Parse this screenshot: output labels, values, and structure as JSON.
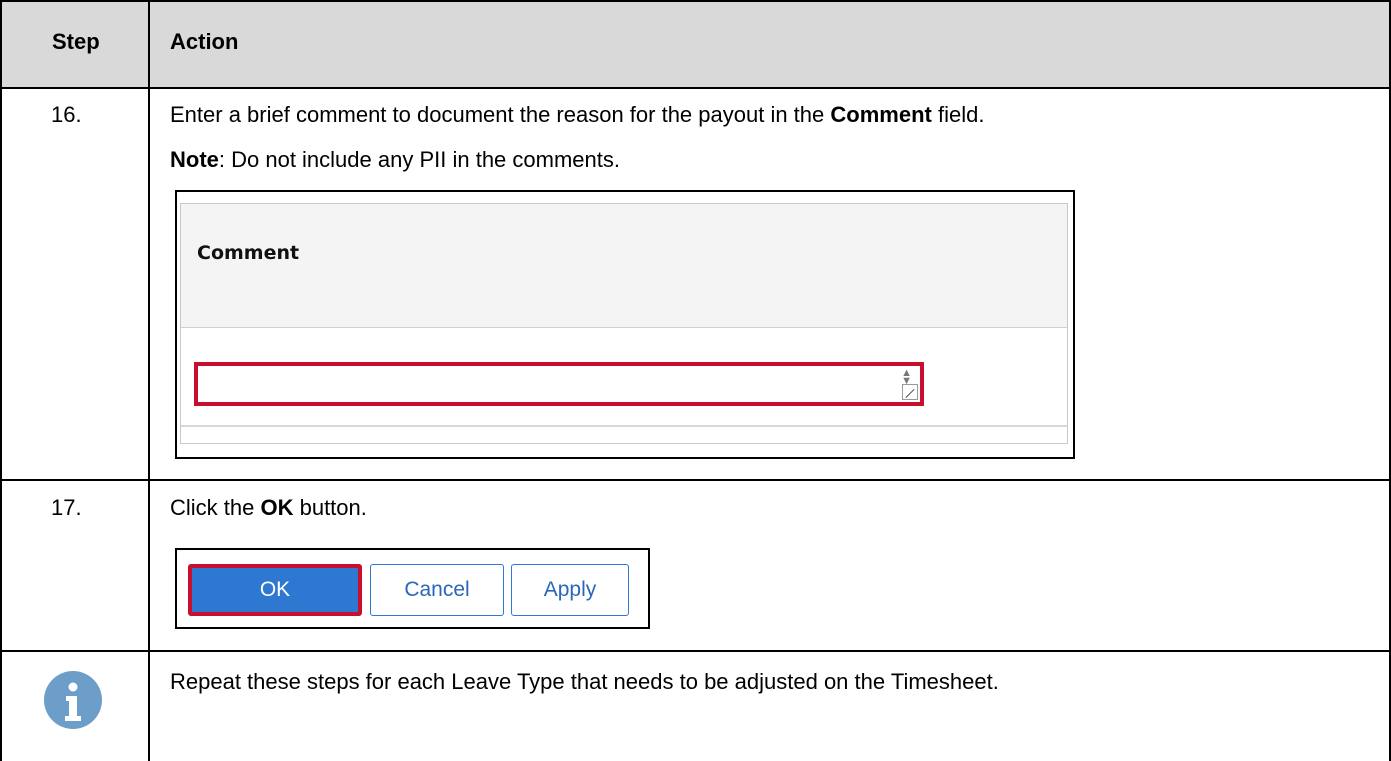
{
  "table": {
    "headers": {
      "step": "Step",
      "action": "Action"
    }
  },
  "rows": [
    {
      "step": "16.",
      "instruction": {
        "pre": "Enter a brief comment to document the reason for the payout in the ",
        "bold": "Comment",
        "post": " field."
      },
      "note": {
        "bold": "Note",
        "text": ": Do not include any PII in the comments."
      },
      "screenshot": {
        "field_label": "Comment",
        "field_value": ""
      }
    },
    {
      "step": "17.",
      "instruction": {
        "pre": "Click the ",
        "bold": "OK",
        "post": " button."
      },
      "screenshot": {
        "ok": "OK",
        "cancel": "Cancel",
        "apply": "Apply"
      }
    },
    {
      "icon": "info-icon",
      "text": "Repeat these steps for each Leave Type that needs to be adjusted on the Timesheet."
    }
  ],
  "colors": {
    "header_bg": "#d9d9d9",
    "highlight": "#c8102e",
    "button_blue": "#2e78d2",
    "info_icon": "#6d9ec9"
  }
}
